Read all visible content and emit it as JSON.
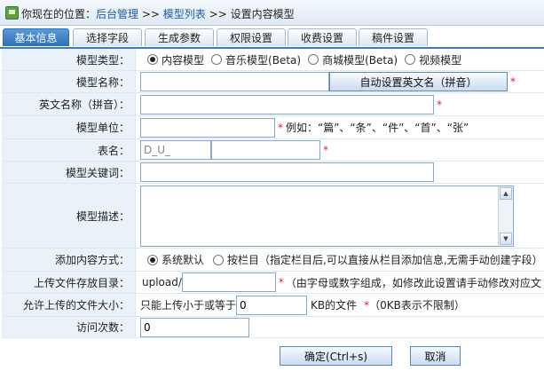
{
  "breadcrumb": {
    "prefix": "你现在的位置：",
    "item1": "后台管理",
    "sep": ">>",
    "item2": "模型列表",
    "current": "设置内容模型"
  },
  "tabs": [
    "基本信息",
    "选择字段",
    "生成参数",
    "权限设置",
    "收费设置",
    "稿件设置"
  ],
  "form": {
    "model_type": {
      "label": "模型类型：",
      "options": [
        "内容模型",
        "音乐模型(Beta)",
        "商城模型(Beta)",
        "视频模型"
      ],
      "selected": "内容模型"
    },
    "model_name": {
      "label": "模型名称：",
      "value": "",
      "button": "自动设置英文名（拼音）",
      "req": "*"
    },
    "english_name": {
      "label": "英文名称（拼音）：",
      "value": "",
      "req": "*"
    },
    "model_unit": {
      "label": "模型单位：",
      "value": "",
      "req": "*",
      "hint": "例如：“篇”、“条”、“件”、“首”、“张”"
    },
    "table_name": {
      "label": "表名：",
      "prefix": "D_U_",
      "value": "",
      "req": "*"
    },
    "keywords": {
      "label": "模型关键词：",
      "value": ""
    },
    "description": {
      "label": "模型描述：",
      "value": ""
    },
    "add_method": {
      "label": "添加内容方式：",
      "options": [
        "系统默认",
        "按栏目（指定栏目后,可以直接从栏目添加信息,无需手动创建字段）"
      ],
      "selected": "系统默认"
    },
    "upload_dir": {
      "label": "上传文件存放目录：",
      "prefix": "upload/",
      "value": "",
      "req": "*",
      "hint": "（由字母或数字组成，如修改此设置请手动修改对应文"
    },
    "max_size": {
      "label": "允许上传的文件大小：",
      "before": "只能上传小于或等于",
      "value": "0",
      "after": "KB的文件",
      "req": "*",
      "hint": "（0KB表示不限制）"
    },
    "visits": {
      "label": "访问次数：",
      "value": "0"
    }
  },
  "buttons": {
    "submit": "确定(Ctrl+s)",
    "cancel": "取消"
  },
  "colors": {
    "accent": "#2f6fb3",
    "label_bg": "#e9f1f9",
    "required": "#e0204a",
    "link": "#1d5aa8"
  }
}
